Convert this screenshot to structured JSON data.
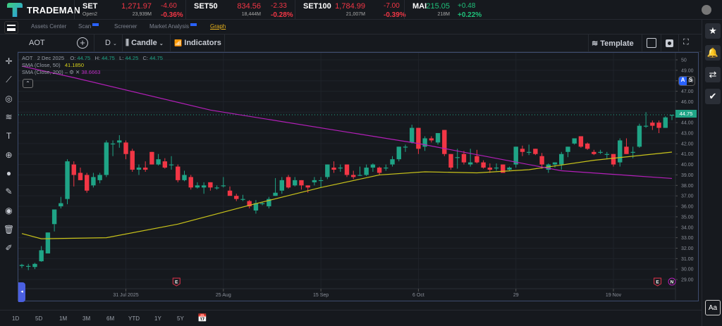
{
  "brand": {
    "name": "TRADEMAN"
  },
  "tickers": [
    {
      "name": "SET",
      "sub": "Open2",
      "price": "1,271.97",
      "change": "-4.60",
      "volume": "23,939M",
      "pct": "-0.36%",
      "dir": "down"
    },
    {
      "name": "SET50",
      "sub": "",
      "price": "834.56",
      "change": "-2.33",
      "volume": "18,444M",
      "pct": "-0.28%",
      "dir": "down"
    },
    {
      "name": "SET100",
      "sub": "",
      "price": "1,784.99",
      "change": "-7.00",
      "volume": "21,007M",
      "pct": "-0.39%",
      "dir": "down"
    },
    {
      "name": "MAI",
      "sub": "",
      "price": "215.05",
      "change": "+0.48",
      "volume": "218M",
      "pct": "+0.22%",
      "dir": "up"
    }
  ],
  "nav": {
    "items": [
      {
        "label": "Assets Center"
      },
      {
        "label": "Scan",
        "badge": true
      },
      {
        "label": "Screener"
      },
      {
        "label": "Market Analysis",
        "badge": true
      },
      {
        "label": "Graph",
        "active": true
      }
    ]
  },
  "toolbar": {
    "symbol": "AOT",
    "interval": "D",
    "chart_type": "Candle",
    "indicators": "Indicators",
    "template": "Template"
  },
  "legend": {
    "symbol": "AOT",
    "date": "2 Dec 2025",
    "o_label": "O:",
    "o": "44.75",
    "h_label": "H:",
    "h": "44.75",
    "l_label": "L:",
    "l": "44.25",
    "c_label": "C:",
    "c": "44.75",
    "sma50_label": "SMA (Close, 50)",
    "sma50_value": "41.1850",
    "sma200_label": "SMA (Close, 200)",
    "sma200_value": "38.6663"
  },
  "scale_buttons": {
    "auto": "A",
    "scale": "S"
  },
  "last_price": "44.75",
  "ranges": [
    "1D",
    "5D",
    "1M",
    "3M",
    "6M",
    "YTD",
    "1Y",
    "5Y"
  ],
  "font_button": "Aa",
  "colors": {
    "up": "#1fa486",
    "down": "#f23645",
    "sma50": "#c8c21a",
    "sma200": "#b31fb8",
    "accent": "#2962ff",
    "graph_active": "#e8b21c"
  },
  "chart_data": {
    "type": "candlestick",
    "ylim": [
      28.5,
      50.5
    ],
    "yticks": [
      29,
      30,
      31,
      32,
      33,
      34,
      35,
      36,
      37,
      38,
      39,
      40,
      41,
      42,
      43,
      44,
      45,
      46,
      47,
      48,
      49,
      50
    ],
    "xticks": [
      {
        "bar": 17,
        "label": "31 Jul 2025"
      },
      {
        "bar": 32,
        "label": "25 Aug"
      },
      {
        "bar": 47,
        "label": "15 Sep"
      },
      {
        "bar": 62,
        "label": "6 Oct"
      },
      {
        "bar": 77,
        "label": "29"
      },
      {
        "bar": 92,
        "label": "19 Nov"
      }
    ],
    "candles": [
      [
        30.3,
        30.5,
        30.1,
        30.4
      ],
      [
        30.3,
        30.5,
        29.9,
        30.3
      ],
      [
        30.2,
        30.6,
        30.0,
        30.5
      ],
      [
        30.75,
        32.2,
        30.7,
        31.8
      ],
      [
        31.5,
        33.5,
        31.5,
        33.5
      ],
      [
        34.3,
        34.3,
        33.6,
        35.7
      ],
      [
        36.0,
        36.9,
        35.8,
        36.3
      ],
      [
        36.7,
        40.5,
        36.2,
        40.3
      ],
      [
        40.0,
        40.3,
        37.9,
        39.0
      ],
      [
        39.2,
        39.7,
        38.5,
        38.5
      ],
      [
        39.0,
        39.2,
        37.3,
        37.5
      ],
      [
        38.0,
        39.2,
        37.8,
        38.8
      ],
      [
        38.5,
        39.2,
        38.2,
        39.0
      ],
      [
        39.0,
        42.3,
        38.8,
        42.1
      ],
      [
        42.0,
        42.3,
        40.8,
        42.0
      ],
      [
        42.1,
        42.8,
        41.6,
        42.3
      ],
      [
        42.1,
        42.3,
        40.5,
        41.0
      ],
      [
        41.3,
        41.5,
        39.3,
        39.5
      ],
      [
        39.5,
        40.0,
        39.0,
        39.7
      ],
      [
        39.7,
        40.3,
        39.3,
        39.5
      ],
      [
        41.2,
        41.2,
        40.0,
        40.0
      ],
      [
        40.0,
        41.0,
        39.9,
        40.5
      ],
      [
        40.3,
        40.6,
        39.6,
        39.7
      ],
      [
        40.0,
        40.8,
        39.5,
        40.0
      ],
      [
        39.8,
        40.0,
        38.3,
        38.5
      ],
      [
        38.5,
        39.4,
        38.4,
        39.0
      ],
      [
        38.8,
        39.0,
        37.6,
        37.8
      ],
      [
        37.8,
        38.3,
        37.7,
        38.0
      ],
      [
        37.8,
        38.3,
        37.2,
        38.0
      ],
      [
        38.3,
        38.3,
        37.5,
        37.8
      ],
      [
        37.8,
        38.0,
        37.6,
        37.8
      ],
      [
        38.0,
        38.8,
        37.8,
        38.0
      ],
      [
        37.5,
        37.9,
        37.1,
        37.0
      ],
      [
        37.0,
        37.2,
        36.5,
        36.7
      ],
      [
        36.7,
        37.1,
        36.5,
        36.7
      ],
      [
        36.5,
        36.6,
        35.8,
        36.0
      ],
      [
        35.6,
        36.6,
        35.3,
        36.3
      ],
      [
        36.3,
        36.4,
        36.1,
        36.3
      ],
      [
        36.0,
        36.9,
        35.8,
        36.7
      ],
      [
        37.0,
        38.7,
        37.0,
        37.3
      ],
      [
        37.5,
        38.8,
        37.2,
        38.5
      ],
      [
        38.8,
        39.0,
        37.7,
        37.8
      ],
      [
        38.0,
        38.8,
        37.9,
        38.5
      ],
      [
        38.5,
        38.5,
        37.6,
        38.0
      ],
      [
        38.0,
        38.0,
        37.3,
        37.8
      ],
      [
        38.3,
        38.8,
        38.0,
        38.5
      ],
      [
        38.5,
        38.8,
        37.8,
        38.5
      ],
      [
        38.8,
        40.0,
        38.6,
        40.0
      ],
      [
        39.7,
        40.3,
        39.2,
        39.5
      ],
      [
        39.7,
        40.0,
        39.3,
        39.7
      ],
      [
        40.0,
        40.0,
        38.8,
        39.0
      ],
      [
        39.0,
        39.4,
        38.6,
        38.8
      ],
      [
        39.0,
        39.8,
        38.9,
        39.0
      ],
      [
        39.0,
        40.0,
        38.9,
        39.7
      ],
      [
        39.7,
        40.1,
        39.3,
        40.0
      ],
      [
        39.7,
        39.8,
        39.0,
        39.2
      ],
      [
        39.7,
        40.0,
        39.4,
        39.7
      ],
      [
        40.0,
        40.8,
        39.8,
        40.5
      ],
      [
        40.5,
        41.7,
        40.3,
        41.7
      ],
      [
        41.7,
        41.9,
        41.2,
        41.7
      ],
      [
        42.1,
        43.8,
        42.0,
        43.5
      ],
      [
        43.5,
        43.5,
        41.0,
        41.5
      ],
      [
        41.7,
        42.7,
        41.3,
        42.5
      ],
      [
        42.5,
        42.7,
        42.1,
        42.3
      ],
      [
        42.1,
        43.0,
        41.9,
        43.0
      ],
      [
        43.3,
        43.3,
        40.8,
        41.0
      ],
      [
        41.0,
        41.0,
        39.5,
        39.7
      ],
      [
        40.7,
        41.5,
        39.6,
        40.7
      ],
      [
        41.0,
        41.3,
        40.0,
        40.2
      ],
      [
        40.0,
        41.5,
        39.8,
        40.2
      ],
      [
        40.8,
        41.4,
        40.1,
        40.2
      ],
      [
        40.2,
        40.4,
        39.6,
        39.7
      ],
      [
        39.7,
        40.1,
        39.2,
        39.5
      ],
      [
        39.7,
        40.1,
        39.4,
        39.7
      ],
      [
        40.0,
        40.0,
        39.2,
        39.2
      ],
      [
        39.5,
        39.8,
        39.4,
        39.7
      ],
      [
        40.0,
        41.7,
        39.7,
        41.7
      ],
      [
        41.5,
        41.8,
        40.8,
        41.2
      ],
      [
        41.2,
        41.9,
        40.9,
        41.2
      ],
      [
        41.5,
        41.5,
        40.9,
        41.0
      ],
      [
        40.8,
        41.1,
        39.6,
        40.0
      ],
      [
        39.5,
        40.1,
        39.2,
        40.0
      ],
      [
        40.0,
        40.2,
        39.7,
        40.2
      ],
      [
        40.0,
        41.2,
        39.5,
        41.0
      ],
      [
        41.2,
        41.7,
        40.7,
        41.7
      ],
      [
        42.0,
        42.3,
        41.9,
        42.5
      ],
      [
        42.7,
        42.7,
        41.6,
        41.7
      ],
      [
        42.0,
        42.1,
        41.4,
        41.5
      ],
      [
        41.2,
        41.4,
        40.9,
        41.0
      ],
      [
        41.2,
        41.4,
        41.0,
        41.2
      ],
      [
        41.0,
        41.2,
        40.5,
        41.0
      ],
      [
        41.0,
        41.0,
        39.8,
        40.0
      ],
      [
        40.2,
        42.5,
        39.8,
        42.3
      ],
      [
        41.7,
        42.5,
        41.0,
        41.0
      ],
      [
        41.2,
        41.7,
        40.6,
        41.2
      ],
      [
        41.7,
        43.9,
        41.6,
        43.7
      ],
      [
        43.7,
        45.0,
        43.5,
        43.7
      ],
      [
        44.0,
        44.2,
        43.3,
        43.7
      ],
      [
        44.0,
        44.2,
        43.0,
        43.5
      ],
      [
        43.5,
        44.6,
        43.5,
        44.5
      ],
      [
        44.75,
        44.75,
        44.25,
        44.75
      ]
    ],
    "series": [
      {
        "name": "SMA (Close, 50)",
        "points": [
          [
            1,
            33.4
          ],
          [
            4,
            32.9
          ],
          [
            14,
            33.0
          ],
          [
            25,
            34.3
          ],
          [
            36,
            36.1
          ],
          [
            47,
            37.8
          ],
          [
            56,
            39.0
          ],
          [
            63,
            39.3
          ],
          [
            71,
            39.2
          ],
          [
            79,
            39.5
          ],
          [
            89,
            40.4
          ],
          [
            101,
            41.185
          ]
        ]
      },
      {
        "name": "SMA (Close, 200)",
        "points": [
          [
            1,
            49.4
          ],
          [
            9,
            48.3
          ],
          [
            30,
            45.2
          ],
          [
            51,
            43.1
          ],
          [
            62,
            42.0
          ],
          [
            73,
            40.7
          ],
          [
            84,
            39.4
          ],
          [
            101,
            38.6663
          ]
        ]
      }
    ],
    "events": [
      {
        "bar": 25,
        "label": "E"
      },
      {
        "bar": 99,
        "label": "E"
      },
      {
        "bar": 101,
        "label": "N"
      }
    ]
  }
}
